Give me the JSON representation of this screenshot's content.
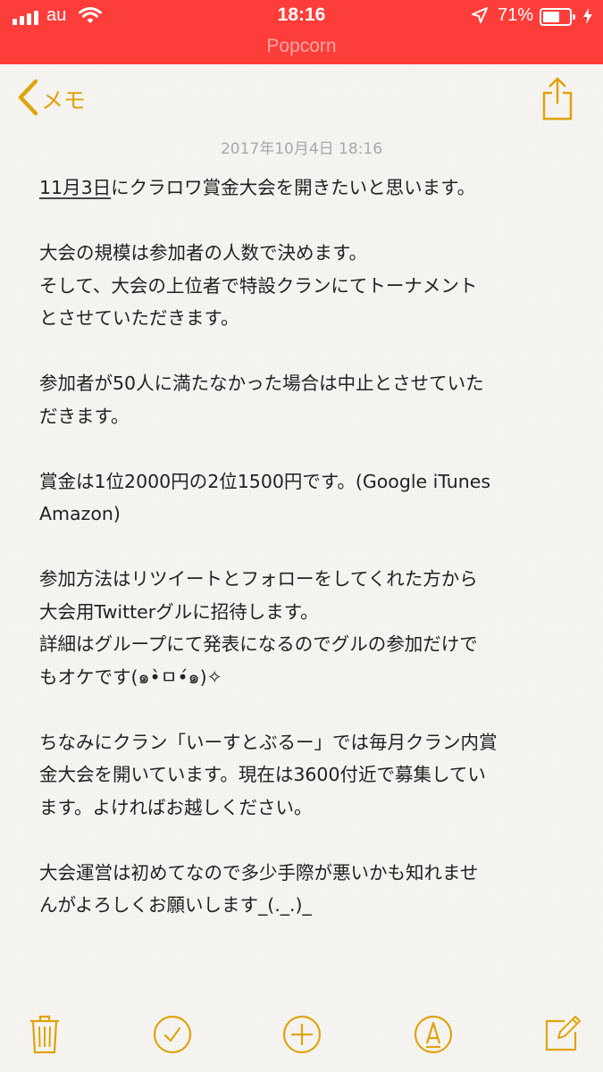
{
  "status_bar": {
    "carrier": "au",
    "time": "18:16",
    "subtitle": "Popcorn",
    "battery_percent_label": "71%",
    "battery_level": 0.71,
    "signal_bars": 4
  },
  "nav": {
    "back_label": "メモ",
    "back_icon": "chevron-left-icon",
    "share_icon": "share-icon"
  },
  "note": {
    "date": "2017年10月4日 18:16",
    "date_link_text": "11月3日",
    "lines": [
      "にクラロワ賞金大会を開きたいと思います。",
      "",
      "大会の規模は参加者の人数で決めます。",
      "そして、大会の上位者で特設クランにてトーナメント",
      "とさせていただきます。",
      "",
      "参加者が50人に満たなかった場合は中止とさせていた",
      "だきます。",
      "",
      "賞金は1位2000円の2位1500円です。(Google iTunes",
      "Amazon)",
      "",
      "参加方法はリツイートとフォローをしてくれた方から",
      "大会用Twitterグルに招待します。",
      "詳細はグループにて発表になるのでグルの参加だけで",
      "もオケです(๑•̀ㅁ•́๑)✧",
      "",
      "ちなみにクラン「いーすとぶるー」では毎月クラン内賞",
      "金大会を開いています。現在は3600付近で募集してい",
      "ます。よければお越しください。",
      "",
      "大会運営は初めてなので多少手際が悪いかも知れませ",
      "んがよろしくお願いします_(._.)_"
    ]
  },
  "toolbar": {
    "items": [
      "trash-icon",
      "checklist-icon",
      "add-icon",
      "markup-icon",
      "compose-icon"
    ]
  },
  "colors": {
    "accent": "#e0a30e",
    "status_bar": "#fc3d39",
    "date_text": "#a8a8a8"
  }
}
